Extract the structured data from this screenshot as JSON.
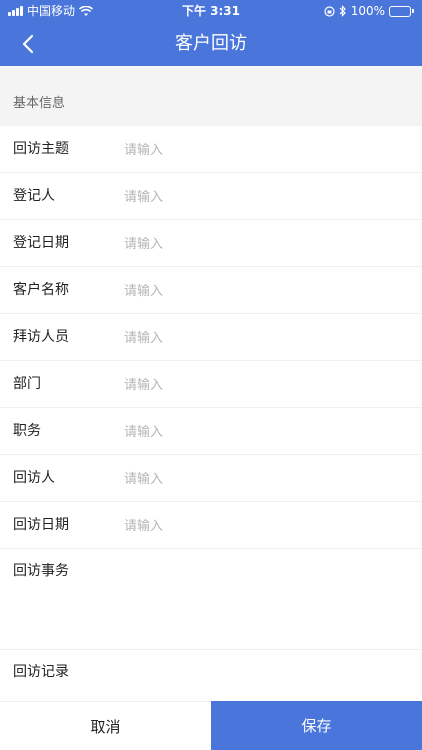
{
  "status_bar": {
    "carrier": "中国移动",
    "time": "下午 3:31",
    "battery": "100%"
  },
  "nav": {
    "title": "客户回访",
    "back_icon": "chevron-left-icon"
  },
  "section": {
    "title": "基本信息"
  },
  "fields": [
    {
      "label": "回访主题",
      "placeholder": "请输入",
      "value": ""
    },
    {
      "label": "登记人",
      "placeholder": "请输入",
      "value": ""
    },
    {
      "label": "登记日期",
      "placeholder": "请输入",
      "value": ""
    },
    {
      "label": "客户名称",
      "placeholder": "请输入",
      "value": ""
    },
    {
      "label": "拜访人员",
      "placeholder": "请输入",
      "value": ""
    },
    {
      "label": "部门",
      "placeholder": "请输入",
      "value": ""
    },
    {
      "label": "职务",
      "placeholder": "请输入",
      "value": ""
    },
    {
      "label": "回访人",
      "placeholder": "请输入",
      "value": ""
    },
    {
      "label": "回访日期",
      "placeholder": "请输入",
      "value": ""
    }
  ],
  "matters": {
    "label": "回访事务",
    "value": ""
  },
  "record": {
    "label": "回访记录"
  },
  "actions": {
    "cancel": "取消",
    "save": "保存"
  },
  "colors": {
    "accent": "#4a76db",
    "section_bg": "#f4f4f5",
    "placeholder": "#b5b5b5"
  }
}
